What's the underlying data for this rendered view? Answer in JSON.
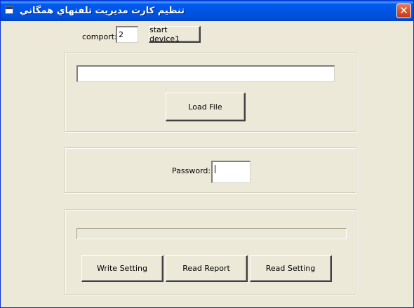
{
  "window": {
    "title": "تنظيم كارت مديريت تلفنهاي همگاني",
    "close_symbol": "✕"
  },
  "connection": {
    "comport_label": "comport:",
    "comport_value": "2",
    "start_button_label": "start device1"
  },
  "file_section": {
    "file_path_value": "",
    "load_button_label": "Load File"
  },
  "password_section": {
    "password_label": "Password:",
    "password_value": ""
  },
  "settings_section": {
    "progress_percent": 0,
    "write_button_label": "Write Setting",
    "report_button_label": "Read Report",
    "read_button_label": "Read Setting"
  },
  "colors": {
    "titlebar": "#0054E3",
    "window_bg": "#ECE9D8",
    "close_button": "#D7532E"
  },
  "icons": {
    "app": "app-window-icon",
    "close": "close-icon"
  }
}
